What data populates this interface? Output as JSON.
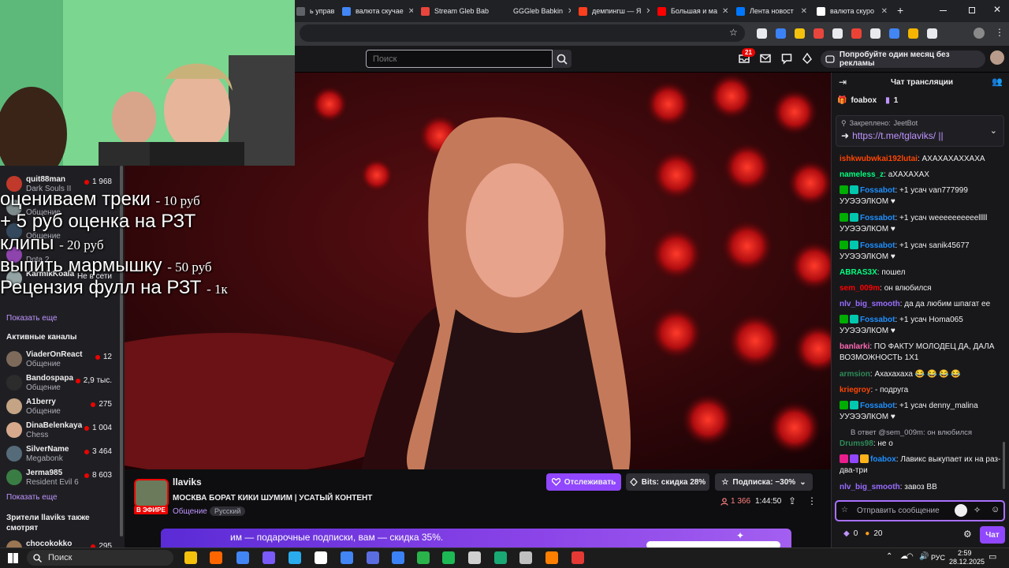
{
  "browser": {
    "tabs": [
      {
        "label": "ь управ",
        "color": "#5f6368"
      },
      {
        "label": "валюта скучае",
        "color": "#4285f4"
      },
      {
        "label": "Stream Gleb Bab",
        "color": "#e8453c"
      },
      {
        "label": "GGGleb Babkin",
        "color": "#202124"
      },
      {
        "label": "демпингш — Я",
        "color": "#fc3f1d"
      },
      {
        "label": "Большая и ма",
        "color": "#ff0000"
      },
      {
        "label": "Лента новост",
        "color": "#0077ff"
      },
      {
        "label": "валюта скуро",
        "color": "#ffffff"
      }
    ],
    "new_tab": "+"
  },
  "topnav": {
    "search_placeholder": "Поиск",
    "notifications_count": "21",
    "promo_label": "Попробуйте один месяц без рекламы"
  },
  "sidebar": {
    "top_channels": [
      {
        "name": "quit88man",
        "game": "Dark Souls II",
        "viewers": "1 968",
        "color": "#c0392b"
      },
      {
        "name": "",
        "game": "Общение",
        "viewers": "",
        "color": "#7f8c8d"
      },
      {
        "name": "",
        "game": "Общение",
        "viewers": "",
        "color": "#34495e"
      },
      {
        "name": "",
        "game": "Dota 2",
        "viewers": "",
        "color": "#8e44ad"
      },
      {
        "name": "KarmikKoala",
        "game": "",
        "viewers": "Не в сети",
        "color": "#95a5a6"
      }
    ],
    "show_more_1": "Показать еще",
    "active_heading": "Активные каналы",
    "active_channels": [
      {
        "name": "ViaderOnReact",
        "game": "Общение",
        "viewers": "12",
        "color": "#7d6a5a"
      },
      {
        "name": "Bandospapa",
        "game": "Общение",
        "viewers": "2,9 тыс.",
        "color": "#2c2c2c"
      },
      {
        "name": "A1berry",
        "game": "Общение",
        "viewers": "275",
        "color": "#c4a484"
      },
      {
        "name": "DinaBelenkaya",
        "game": "Chess",
        "viewers": "1 004",
        "color": "#d7a98c"
      },
      {
        "name": "SilverName",
        "game": "Megabonk",
        "viewers": "3 464",
        "color": "#556b7a"
      },
      {
        "name": "Jerma985",
        "game": "Resident Evil 6",
        "viewers": "8 603",
        "color": "#3a7d44"
      }
    ],
    "show_more_2": "Показать еще",
    "also_watch_heading": "Зрители llaviks также смотрят",
    "also_watch": [
      {
        "name": "chocokokko",
        "viewers": "295",
        "color": "#9b7653"
      }
    ]
  },
  "overlay": {
    "lines": [
      {
        "text": "оцениваем треки",
        "price": "- 10 руб"
      },
      {
        "text": "+ 5 руб оценка на РЗТ",
        "price": ""
      },
      {
        "text": "клипы",
        "price": "- 20 руб"
      },
      {
        "text": "выпить мармышку",
        "price": "- 50 руб"
      },
      {
        "text": "Рецензия фулл на РЗТ",
        "price": "- 1к"
      }
    ]
  },
  "stream": {
    "channel_name": "llaviks",
    "title": "МОСКВА БОРАТ КИКИ ШУМИМ | УСАТЫЙ КОНТЕНТ",
    "category": "Общение",
    "tag": "Русский",
    "live_badge": "В ЭФИРЕ",
    "follow_label": "Отслеживать",
    "bits_label": "Bits: скидка 28%",
    "sub_label": "Подписка: −30%",
    "viewers": "1 366",
    "uptime": "1:44:50",
    "banner_text": "им — подарочные подписки, вам — скидка 35%."
  },
  "chat": {
    "header": "Чат трансляции",
    "top_gifter": "foabox",
    "top_gifter_count": "1",
    "pinned_label": "Закреплено:",
    "pinned_by": "JeetBot",
    "pinned_text": "https://t.me/tglaviks/ ||",
    "messages": [
      {
        "user": "ishkwubwkai192lutai",
        "color": "#ff4500",
        "text": "АХАХАХАХХАХА"
      },
      {
        "user": "nameless_z",
        "color": "#00ff7f",
        "text": "аХАХАХАХ"
      },
      {
        "user": "Fossabot",
        "color": "#1e90ff",
        "text": "+1 усач van777999 УУЭЭЭЛКОМ ♥"
      },
      {
        "user": "Fossabot",
        "color": "#1e90ff",
        "text": "+1 усач weeeeeeeeeelllll УУЭЭЭЛКОМ ♥"
      },
      {
        "user": "Fossabot",
        "color": "#1e90ff",
        "text": "+1 усач sanik45677 УУЭЭЭЛКОМ ♥"
      },
      {
        "user": "ABRAS3X",
        "color": "#00ff7f",
        "text": "пошел"
      },
      {
        "user": "sem_009m",
        "color": "#ff0000",
        "text": "он влюбился"
      },
      {
        "user": "nlv_big_smooth",
        "color": "#9a6cff",
        "text": "да да любим шпагат ее"
      },
      {
        "user": "Fossabot",
        "color": "#1e90ff",
        "text": "+1 усач Homa065 УУЭЭЭЛКОМ ♥"
      },
      {
        "user": "banlarki",
        "color": "#ff69b4",
        "text": "ПО ФАКТУ МОЛОДЕЦ ДА, ДАЛА ВОЗМОЖНОСТЬ 1Х1"
      },
      {
        "user": "armsion",
        "color": "#2e8b57",
        "text": "Ахахахаха 😂 😂 😂 😂"
      },
      {
        "user": "kriegroy",
        "color": "#ff4500",
        "text": "- подруга"
      },
      {
        "user": "Fossabot",
        "color": "#1e90ff",
        "text": "+1 усач denny_malina УУЭЭЭЛКОМ ♥"
      },
      {
        "user": "Drums98",
        "color": "#2e8b57",
        "text": "не о"
      },
      {
        "user": "foabox",
        "color": "#1e90ff",
        "text": "Лавикс выкупает их на раз-два-три"
      },
      {
        "user": "nlv_big_smooth",
        "color": "#9a6cff",
        "text": "завоз ВВ"
      }
    ],
    "reply_to": "В ответ @sem_009m: он влюбился",
    "input_placeholder": "Отправить сообщение",
    "points": "0",
    "bits_count": "20",
    "chat_button": "Чат"
  },
  "taskbar": {
    "search_label": "Поиск",
    "lang": "РУС",
    "time": "2:59",
    "date": "28.12.2025"
  }
}
